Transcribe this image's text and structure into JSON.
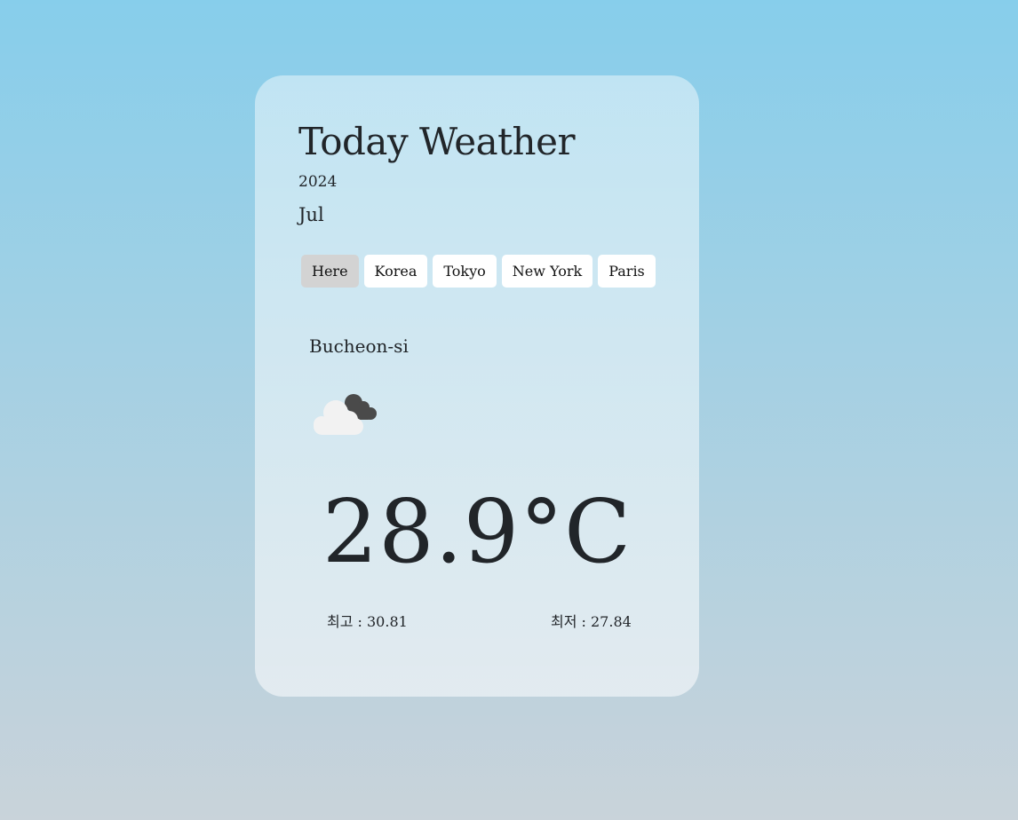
{
  "header": {
    "title": "Today Weather",
    "year": "2024",
    "month": "Jul"
  },
  "tabs": [
    {
      "label": "Here",
      "active": true
    },
    {
      "label": "Korea",
      "active": false
    },
    {
      "label": "Tokyo",
      "active": false
    },
    {
      "label": "New York",
      "active": false
    },
    {
      "label": "Paris",
      "active": false
    }
  ],
  "weather": {
    "city": "Bucheon-si",
    "icon": "cloudy-icon",
    "temperature": "28.9°C",
    "max_text": "최고 : 30.81",
    "min_text": "최저 : 27.84"
  },
  "colors": {
    "background_top": "#87ceeb",
    "background_bottom": "#c9d3da",
    "active_tab": "#d3d3d3",
    "text": "#212529"
  }
}
